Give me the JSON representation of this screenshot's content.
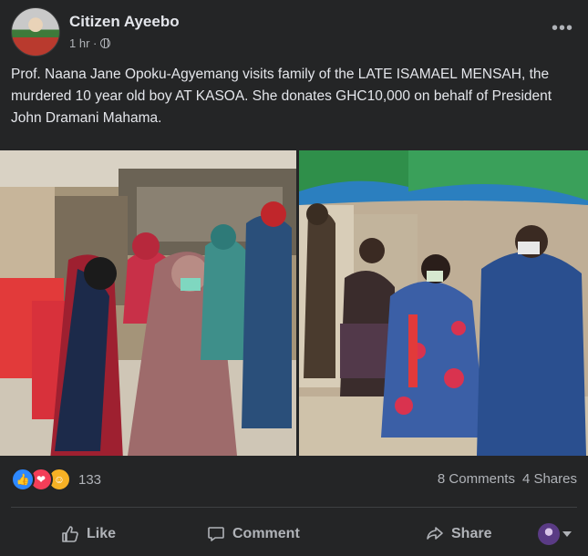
{
  "post": {
    "author": "Citizen Ayeebo",
    "time": "1 hr ·",
    "more_icon": "•••",
    "text": "Prof. Naana Jane Opoku-Agyemang visits family of the LATE ISAMAEL MENSAH, the murdered 10 year old boy AT KASOA. She donates GHC10,000 on behalf of President John Dramani Mahama."
  },
  "reactions": {
    "icons": [
      "like-icon",
      "love-icon",
      "care-icon"
    ],
    "count": "133",
    "comments": "8 Comments",
    "shares": "4 Shares"
  },
  "actions": {
    "like": "Like",
    "comment": "Comment",
    "share": "Share"
  }
}
